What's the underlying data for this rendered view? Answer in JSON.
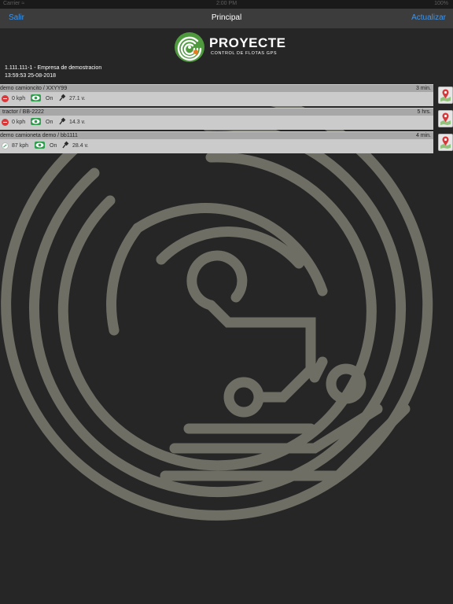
{
  "status_bar": {
    "carrier": "Carrier ≈",
    "time": "2:00 PM",
    "battery": "100%"
  },
  "nav": {
    "left_label": "Salir",
    "title": "Principal",
    "right_label": "Actualizar"
  },
  "brand": {
    "name": "PROYECTE",
    "tagline": "CONTROL DE FLOTAS GPS"
  },
  "account": {
    "company_line": "1.111.111-1 - Empresa de demostracion",
    "timestamp": "13:59:53 25-08-2018"
  },
  "vehicles": [
    {
      "name": "demo camioncito / XXYY99",
      "age": "3 min.",
      "speed": "0 kph",
      "moving": false,
      "status": "On",
      "voltage": "27.1 v."
    },
    {
      "name": "tractor / BB-2222",
      "age": "5 hrs.",
      "speed": "0 kph",
      "moving": false,
      "status": "On",
      "voltage": "14.3 v."
    },
    {
      "name": "demo camioneta demo / bb1111",
      "age": "4 min.",
      "speed": "87 kph",
      "moving": true,
      "status": "On",
      "voltage": "28.4 v."
    }
  ],
  "icons": {
    "map_pin": "map-pin-icon",
    "eye": "eye-icon",
    "plug": "plug-icon",
    "speed": "speed-icon",
    "brand_logo": "proyecte-logo-icon",
    "background_logo": "maze-logo-icon"
  },
  "colors": {
    "background": "#262626",
    "nav_bar": "#3c3c3c",
    "nav_link": "#3f95ea",
    "brand_green": "#4f9a3f",
    "brand_orange": "#e87b22",
    "logo_stroke": "#6e6e64",
    "row_header": "#a7a7a7",
    "row_body": "#cbcbcb",
    "stop_red": "#d8383a",
    "eye_green": "#2e9d4c"
  }
}
